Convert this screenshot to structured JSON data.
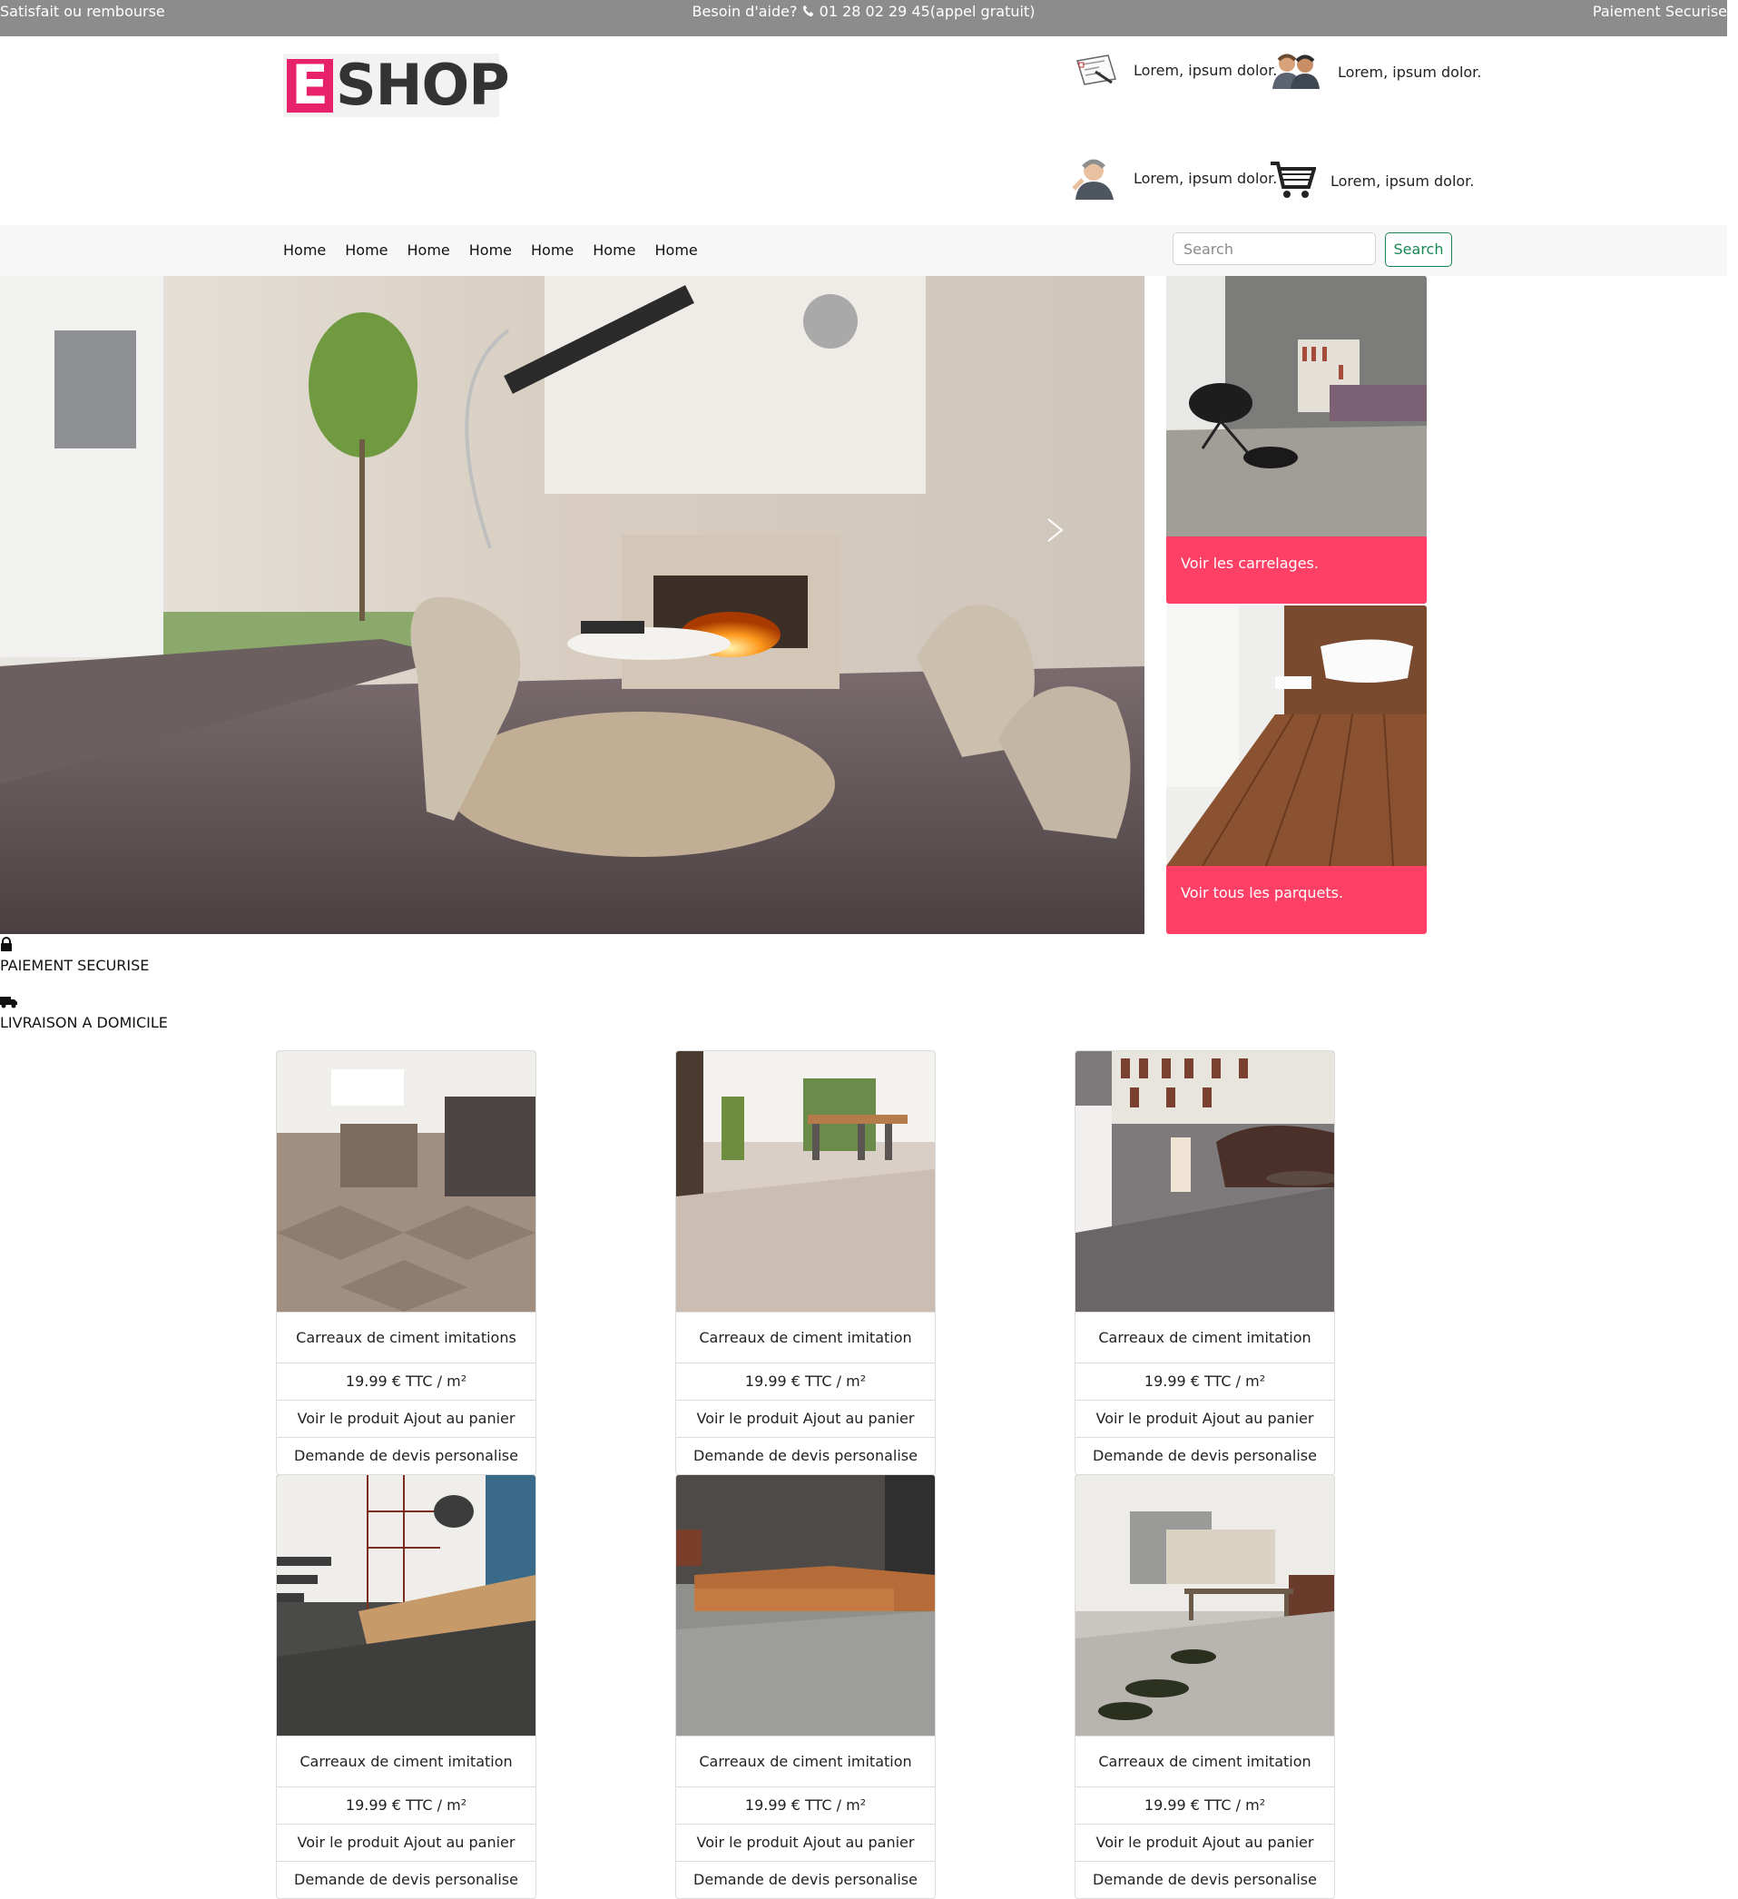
{
  "topbar": {
    "left": "Satisfait ou rembourse",
    "help_prefix": "Besoin d'aide?",
    "phone": "01 28 02 29 45(appel gratuit)",
    "right": "Paiement Securise"
  },
  "logo": {
    "letter": "E",
    "rest": "SHOP"
  },
  "header_features": [
    {
      "icon": "document-icon",
      "text": "Lorem, ipsum dolor."
    },
    {
      "icon": "users-icon",
      "text": "Lorem, ipsum dolor."
    },
    {
      "icon": "support-agent-icon",
      "text": "Lorem, ipsum dolor."
    },
    {
      "icon": "cart-icon",
      "text": "Lorem, ipsum dolor."
    }
  ],
  "nav": {
    "links": [
      "Home",
      "Home",
      "Home",
      "Home",
      "Home",
      "Home",
      "Home"
    ],
    "search_placeholder": "Search",
    "search_button": "Search"
  },
  "side_cards": [
    {
      "caption": "Voir les carrelages."
    },
    {
      "caption": "Voir tous les parquets."
    }
  ],
  "services": [
    {
      "icon": "lock-icon",
      "label": "PAIEMENT SECURISE"
    },
    {
      "icon": "truck-icon",
      "label": "LIVRAISON A DOMICILE"
    }
  ],
  "products": [
    {
      "title": "Carreaux de ciment imitations",
      "price": "19.99 € TTC / m²",
      "actions": "Voir le produit Ajout au panier",
      "quote": "Demande de devis personalise"
    },
    {
      "title": "Carreaux de ciment imitation",
      "price": "19.99 € TTC / m²",
      "actions": "Voir le produit Ajout au panier",
      "quote": "Demande de devis personalise"
    },
    {
      "title": "Carreaux de ciment imitation",
      "price": "19.99 € TTC / m²",
      "actions": "Voir le produit Ajout au panier",
      "quote": "Demande de devis personalise"
    },
    {
      "title": "Carreaux de ciment imitation",
      "price": "19.99 € TTC / m²",
      "actions": "Voir le produit Ajout au panier",
      "quote": "Demande de devis personalise"
    },
    {
      "title": "Carreaux de ciment imitation",
      "price": "19.99 € TTC / m²",
      "actions": "Voir le produit Ajout au panier",
      "quote": "Demande de devis personalise"
    },
    {
      "title": "Carreaux de ciment imitation",
      "price": "19.99 € TTC / m²",
      "actions": "Voir le produit Ajout au panier",
      "quote": "Demande de devis personalise"
    }
  ],
  "colors": {
    "topbar": "#8c8c8c",
    "brand_pink": "#e8216b",
    "card_pink": "#ff4066",
    "search_green": "#198754"
  }
}
